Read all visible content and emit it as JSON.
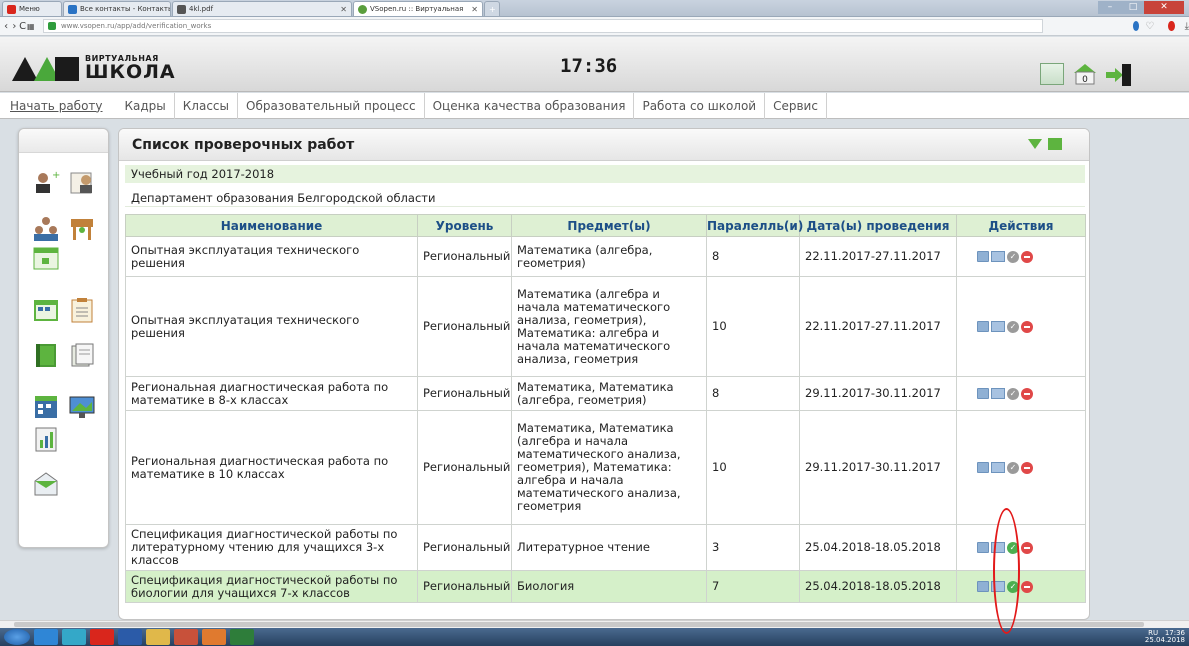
{
  "browser": {
    "tabs": [
      {
        "label": "Меню",
        "color": "#d9261c",
        "active": false
      },
      {
        "label": "Все контакты - Контакты",
        "color": "#2a73c4",
        "active": false
      },
      {
        "label": "4kl.pdf",
        "color": "#555555",
        "active": false
      },
      {
        "label": "VSopen.ru :: Виртуальная",
        "color": "#5a9e3d",
        "active": true
      }
    ],
    "url": "www.vsopen.ru/app/add/verification_works"
  },
  "app": {
    "logo_top": "ВИРТУАЛЬНАЯ",
    "logo_main": "ШКОЛА",
    "clock": "17:36",
    "counter": "0"
  },
  "menu": {
    "start": "Начать работу",
    "items": [
      "Кадры",
      "Классы",
      "Образовательный процесс",
      "Оценка качества образования",
      "Работа со школой",
      "Сервис"
    ]
  },
  "panel": {
    "title": "Список проверочных работ",
    "year": "Учебный год 2017-2018",
    "department": "Департамент образования Белгородской области"
  },
  "table": {
    "headers": [
      "Наименование",
      "Уровень",
      "Предмет(ы)",
      "Паралелль(и)",
      "Дата(ы) проведения",
      "Действия"
    ],
    "rows": [
      {
        "name": "Опытная эксплуатация технического решения",
        "level": "Региональный",
        "subject": "Математика (алгебра, геометрия)",
        "grade": "8",
        "dates": "22.11.2017-27.11.2017",
        "status": "pending",
        "highlight": false
      },
      {
        "name": "Опытная эксплуатация технического решения",
        "level": "Региональный",
        "subject": "Математика (алгебра и начала математического анализа, геометрия), Математика: алгебра и начала математического анализа, геометрия",
        "grade": "10",
        "dates": "22.11.2017-27.11.2017",
        "status": "pending",
        "highlight": false
      },
      {
        "name": "Региональная диагностическая работа по математике в 8-х классах",
        "level": "Региональный",
        "subject": "Математика, Математика (алгебра, геометрия)",
        "grade": "8",
        "dates": "29.11.2017-30.11.2017",
        "status": "pending",
        "highlight": false
      },
      {
        "name": "Региональная диагностическая работа по математике в 10 классах",
        "level": "Региональный",
        "subject": "Математика, Математика (алгебра и начала математического анализа, геометрия), Математика: алгебра и начала математического анализа, геометрия",
        "grade": "10",
        "dates": "29.11.2017-30.11.2017",
        "status": "pending",
        "highlight": false
      },
      {
        "name": "Спецификация диагностической работы по литературному чтению для учащихся 3-х классов",
        "level": "Региональный",
        "subject": "Литературное чтение",
        "grade": "3",
        "dates": "25.04.2018-18.05.2018",
        "status": "approved",
        "highlight": false
      },
      {
        "name": "Спецификация диагностической работы по биологии для учащихся 7-х классов",
        "level": "Региональный",
        "subject": "Биология",
        "grade": "7",
        "dates": "25.04.2018-18.05.2018",
        "status": "approved",
        "highlight": true
      }
    ]
  },
  "taskbar": {
    "lang": "RU",
    "time": "17:36",
    "date": "25.04.2018"
  },
  "colors": {
    "accent_green": "#5db43f",
    "header_blue": "#1d4f87",
    "delete_red": "#e04848",
    "highlight_row": "#d5f0c9"
  }
}
